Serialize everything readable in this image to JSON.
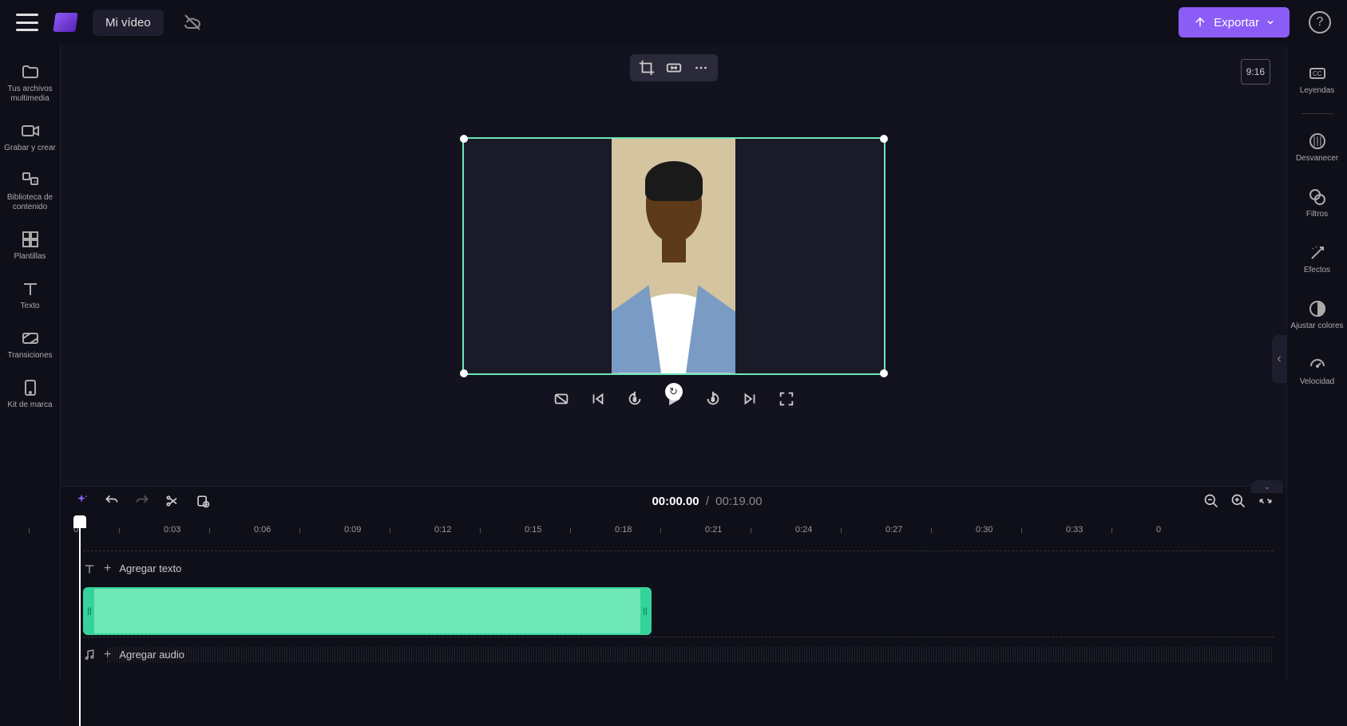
{
  "header": {
    "project_title": "Mi vídeo",
    "export_label": "Exportar"
  },
  "left_sidebar": {
    "items": [
      {
        "label": "Tus archivos multimedia"
      },
      {
        "label": "Grabar y crear"
      },
      {
        "label": "Biblioteca de contenido"
      },
      {
        "label": "Plantillas"
      },
      {
        "label": "Texto"
      },
      {
        "label": "Transiciones"
      },
      {
        "label": "Kit de marca"
      }
    ]
  },
  "right_sidebar": {
    "items": [
      {
        "label": "Leyendas"
      },
      {
        "label": "Desvanecer"
      },
      {
        "label": "Filtros"
      },
      {
        "label": "Efectos"
      },
      {
        "label": "Ajustar colores"
      },
      {
        "label": "Velocidad"
      }
    ]
  },
  "preview": {
    "aspect_ratio": "9:16"
  },
  "timeline": {
    "current_time": "00:00.00",
    "duration": "00:19.00",
    "ruler_marks": [
      "0",
      "0:03",
      "0:06",
      "0:09",
      "0:12",
      "0:15",
      "0:18",
      "0:21",
      "0:24",
      "0:27",
      "0:30",
      "0:33",
      "0"
    ],
    "text_track_label": "Agregar texto",
    "audio_track_label": "Agregar audio"
  },
  "colors": {
    "accent": "#8b5cf6",
    "selection": "#6ee7b7",
    "bg": "#0f0f1a"
  }
}
